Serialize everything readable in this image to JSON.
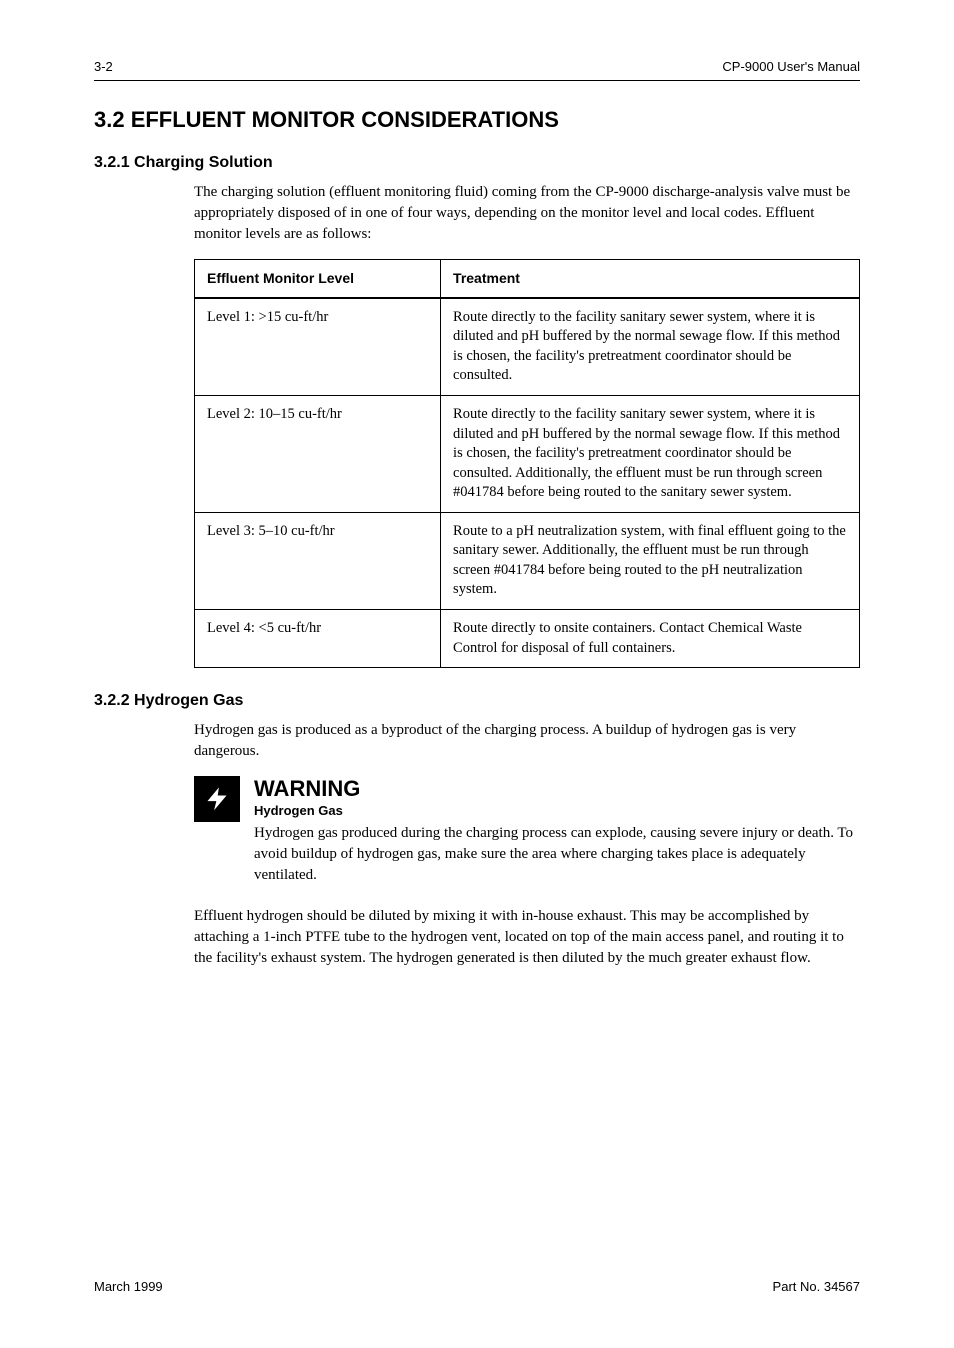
{
  "header": {
    "page_label_left": "3-2",
    "doc_ref_right": "CP-9000 User's Manual"
  },
  "section1": {
    "heading": "3.2  EFFLUENT MONITOR CONSIDERATIONS",
    "subheading": "3.2.1 Charging Solution",
    "para1": "The charging solution (effluent monitoring fluid) coming from the CP-9000 discharge-analysis valve must be appropriately disposed of in one of four ways, depending on the monitor level and local codes. Effluent monitor levels are as follows:",
    "table": {
      "headers": [
        "Effluent Monitor Level",
        "Treatment"
      ],
      "rows": [
        {
          "level": "Level 1:  >15 cu-ft/hr",
          "treatment": "Route directly to the facility sanitary sewer system, where it is diluted and pH buffered by the normal sewage flow. If this method is chosen, the facility's pretreatment coordinator should be consulted."
        },
        {
          "level": "Level 2:  10–15 cu-ft/hr",
          "treatment": "Route directly to the facility sanitary sewer system, where it is diluted and pH buffered by the normal sewage flow. If this method is chosen, the facility's pretreatment coordinator should be consulted. Additionally, the effluent must be run through screen #041784 before being routed to the sanitary sewer system."
        },
        {
          "level": "Level 3:  5–10 cu-ft/hr",
          "treatment": "Route to a pH neutralization system, with final effluent going to the sanitary sewer. Additionally, the effluent must be run through screen #041784 before being routed to the pH neutralization system."
        },
        {
          "level": "Level 4:  <5 cu-ft/hr",
          "treatment": "Route directly to onsite containers. Contact Chemical Waste Control for disposal of full containers."
        }
      ]
    }
  },
  "section2": {
    "subheading": "3.2.2 Hydrogen Gas",
    "para1": "Hydrogen gas is produced as a byproduct of the charging process. A buildup of hydrogen gas is very dangerous.",
    "warning_label": "WARNING",
    "warning_sub": "Hydrogen Gas",
    "warning_text": "Hydrogen gas produced during the charging process can explode, causing severe injury or death. To avoid buildup of hydrogen gas, make sure the area where charging takes place is adequately ventilated.",
    "para2": "Effluent hydrogen should be diluted by mixing it with in-house exhaust. This may be accomplished by attaching a 1-inch PTFE tube to the hydrogen vent, located on top of the main access panel, and routing it to the facility's exhaust system. The hydrogen generated is then diluted by the much greater exhaust flow."
  },
  "footer": {
    "left": "March 1999",
    "right": "Part No. 34567"
  }
}
